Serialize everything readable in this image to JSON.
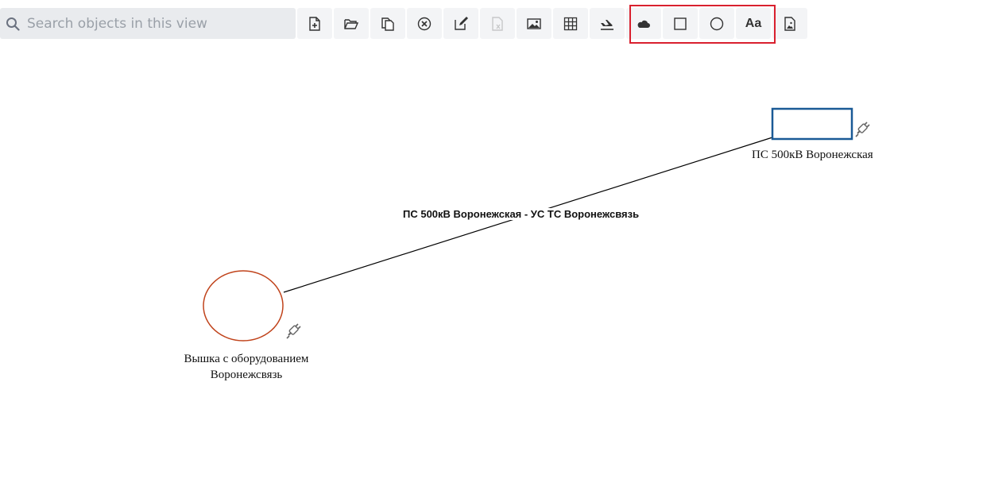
{
  "search": {
    "placeholder": "Search objects in this view",
    "value": ""
  },
  "toolbar": {
    "buttons": [
      {
        "icon": "new-file-icon"
      },
      {
        "icon": "open-folder-icon"
      },
      {
        "icon": "copy-icon"
      },
      {
        "icon": "delete-icon"
      },
      {
        "icon": "edit-icon"
      },
      {
        "icon": "excel-export-icon",
        "disabled": true
      },
      {
        "icon": "image-icon"
      },
      {
        "icon": "grid-icon"
      },
      {
        "icon": "flight-icon"
      },
      {
        "icon": "cloud-icon"
      },
      {
        "icon": "rectangle-icon"
      },
      {
        "icon": "circle-icon"
      },
      {
        "icon": "text-icon",
        "label": "Aa"
      },
      {
        "icon": "file-image-icon"
      }
    ],
    "highlight_color": "#d9202e"
  },
  "diagram": {
    "nodes": [
      {
        "label": "ПС 500кВ Воронежская",
        "shape": "rectangle",
        "color": "#1a5a96"
      },
      {
        "label_line1": "Вышка с оборудованием",
        "label_line2": "Воронежсвязь",
        "shape": "circle",
        "color": "#c0431b"
      }
    ],
    "edges": [
      {
        "label": "ПС 500кВ Воронежская - УС ТС Воронежсвязь"
      }
    ]
  }
}
